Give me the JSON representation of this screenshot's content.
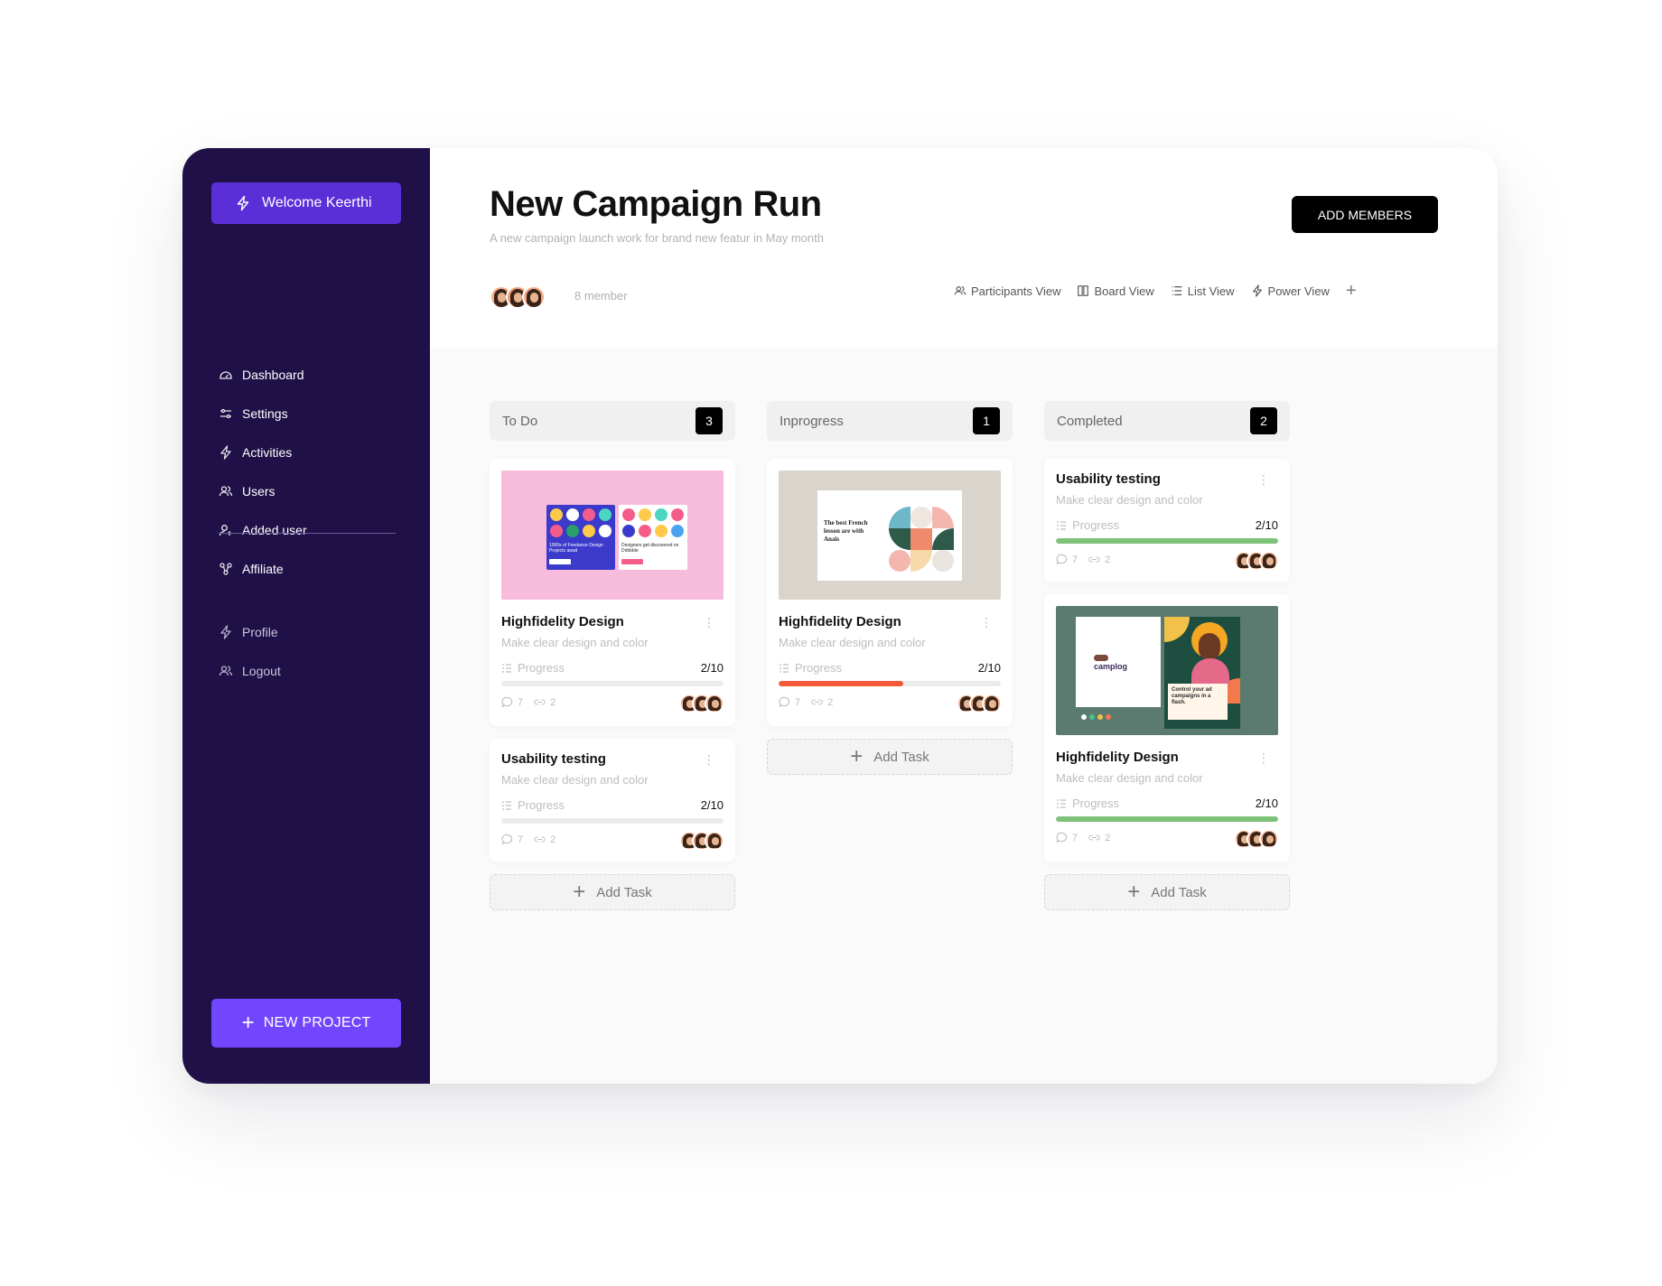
{
  "sidebar": {
    "welcome": "Welcome Keerthi",
    "nav": [
      {
        "label": "Dashboard",
        "icon": "dashboard-icon"
      },
      {
        "label": "Settings",
        "icon": "sliders-icon"
      },
      {
        "label": "Activities",
        "icon": "lightning-icon"
      },
      {
        "label": "Users",
        "icon": "users-icon"
      },
      {
        "label": "Added user",
        "icon": "user-plus-icon"
      },
      {
        "label": "Affiliate",
        "icon": "affiliate-icon"
      }
    ],
    "secondary": [
      {
        "label": "Profile",
        "icon": "lightning-icon"
      },
      {
        "label": "Logout",
        "icon": "users-icon"
      }
    ],
    "new_project": "NEW PROJECT"
  },
  "header": {
    "title": "New Campaign Run",
    "subtitle": "A new campaign launch work for brand new featur in May month",
    "add_members": "ADD MEMBERS",
    "members_label": "8 member",
    "views": [
      {
        "label": "Participants View",
        "icon": "users-icon"
      },
      {
        "label": "Board View",
        "icon": "board-icon"
      },
      {
        "label": "List View",
        "icon": "list-icon"
      },
      {
        "label": "Power View",
        "icon": "lightning-icon"
      }
    ]
  },
  "colors": {
    "sidebar_bg": "#1f1047",
    "accent": "#7246ff",
    "progress_inprogress": "#f25a3a",
    "progress_completed": "#7fc27a"
  },
  "columns": [
    {
      "title": "To Do",
      "count": "3",
      "add_task": "Add Task",
      "cards": [
        {
          "title": "Highfidelity Design",
          "desc": "Make clear design and color",
          "progress_label": "Progress",
          "progress": "2/10",
          "progress_fraction": 0,
          "comments": "7",
          "links": "2",
          "thumb": "freelance-design-thumbnail",
          "thumb_text": [
            "1000s of Freelance Design Projects await",
            "Designers get discovered on Dribbble"
          ]
        },
        {
          "title": "Usability testing",
          "desc": "Make clear design and color",
          "progress_label": "Progress",
          "progress": "2/10",
          "progress_fraction": 0,
          "comments": "7",
          "links": "2"
        }
      ]
    },
    {
      "title": "Inprogress",
      "count": "1",
      "add_task": "Add Task",
      "cards": [
        {
          "title": "Highfidelity Design",
          "desc": "Make clear design and color",
          "progress_label": "Progress",
          "progress": "2/10",
          "progress_fraction": 0.56,
          "comments": "7",
          "links": "2",
          "thumb": "french-lesson-thumbnail",
          "thumb_text": [
            "The best French lesson are with Anaïs"
          ]
        }
      ]
    },
    {
      "title": "Completed",
      "count": "2",
      "add_task": "Add Task",
      "cards": [
        {
          "title": "Usability testing",
          "desc": "Make clear design and color",
          "progress_label": "Progress",
          "progress": "2/10",
          "progress_fraction": 1,
          "comments": "7",
          "links": "2"
        },
        {
          "title": "Highfidelity Design",
          "desc": "Make clear design and color",
          "progress_label": "Progress",
          "progress": "2/10",
          "progress_fraction": 1,
          "comments": "7",
          "links": "2",
          "thumb": "campaign-ad-thumbnail",
          "thumb_text": [
            "camplog",
            "Control your ad campaigns in a flash."
          ]
        }
      ]
    }
  ]
}
